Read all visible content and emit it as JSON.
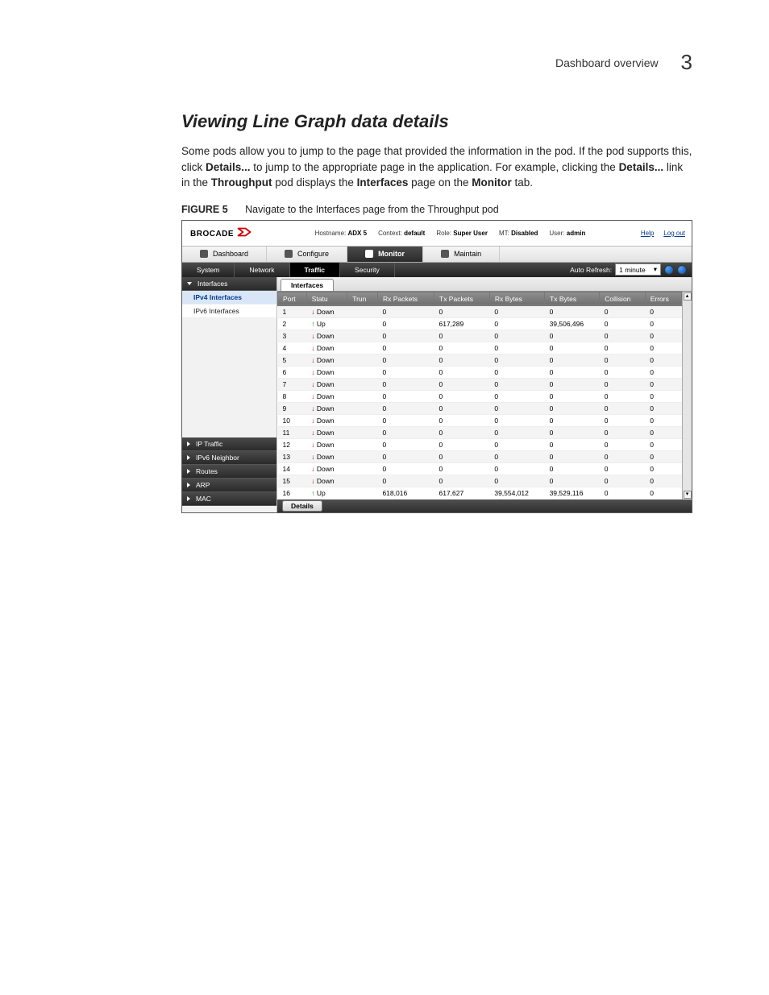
{
  "running_head": {
    "title": "Dashboard overview",
    "page_number": "3"
  },
  "section_title": "Viewing Line Graph data details",
  "body_paragraph": {
    "t1": "Some pods allow you to jump to the page that provided the information in the pod. If the pod supports this, click ",
    "b1": "Details...",
    "t2": " to jump to the appropriate page in the application. For example, clicking the ",
    "b2": "Details...",
    "t3": " link in the ",
    "b3": "Throughput",
    "t4": " pod displays the ",
    "b4": "Interfaces",
    "t5": " page on the ",
    "b5": "Monitor",
    "t6": " tab."
  },
  "figure": {
    "label": "FIGURE 5",
    "caption": "Navigate to the Interfaces page from the Throughput pod"
  },
  "shot": {
    "brand": "BROCADE",
    "top_meta": {
      "hostname_label": "Hostname:",
      "hostname": "ADX 5",
      "context_label": "Context:",
      "context": "default",
      "role_label": "Role:",
      "role": "Super User",
      "mt_label": "MT:",
      "mt": "Disabled",
      "user_label": "User:",
      "user": "admin"
    },
    "top_right": {
      "help": "Help",
      "logout": "Log out"
    },
    "menubar": [
      {
        "label": "Dashboard",
        "sel": false
      },
      {
        "label": "Configure",
        "sel": false
      },
      {
        "label": "Monitor",
        "sel": true
      },
      {
        "label": "Maintain",
        "sel": false
      }
    ],
    "subbar": {
      "tabs": [
        {
          "label": "System",
          "sel": false
        },
        {
          "label": "Network",
          "sel": false
        },
        {
          "label": "Traffic",
          "sel": true
        },
        {
          "label": "Security",
          "sel": false
        }
      ],
      "auto_refresh_label": "Auto Refresh:",
      "auto_refresh_value": "1 minute"
    },
    "sidebar": {
      "sections": [
        {
          "title": "Interfaces",
          "expanded": true,
          "items": [
            {
              "label": "IPv4 Interfaces",
              "active": true
            },
            {
              "label": "IPv6 Interfaces",
              "active": false
            }
          ]
        },
        {
          "title": "IP Traffic",
          "expanded": false,
          "items": []
        },
        {
          "title": "IPv6 Neighbor",
          "expanded": false,
          "items": []
        },
        {
          "title": "Routes",
          "expanded": false,
          "items": []
        },
        {
          "title": "ARP",
          "expanded": false,
          "items": []
        },
        {
          "title": "MAC",
          "expanded": false,
          "items": []
        }
      ]
    },
    "content_tab": "Interfaces",
    "columns": [
      "Port",
      "Statu",
      "Trun",
      "Rx Packets",
      "Tx Packets",
      "Rx Bytes",
      "Tx Bytes",
      "Collision",
      "Errors"
    ],
    "rows": [
      {
        "port": "1",
        "status": "Down",
        "trunk": "",
        "rx_p": "0",
        "tx_p": "0",
        "rx_b": "0",
        "tx_b": "0",
        "col": "0",
        "err": "0"
      },
      {
        "port": "2",
        "status": "Up",
        "trunk": "",
        "rx_p": "0",
        "tx_p": "617,289",
        "rx_b": "0",
        "tx_b": "39,506,496",
        "col": "0",
        "err": "0"
      },
      {
        "port": "3",
        "status": "Down",
        "trunk": "",
        "rx_p": "0",
        "tx_p": "0",
        "rx_b": "0",
        "tx_b": "0",
        "col": "0",
        "err": "0"
      },
      {
        "port": "4",
        "status": "Down",
        "trunk": "",
        "rx_p": "0",
        "tx_p": "0",
        "rx_b": "0",
        "tx_b": "0",
        "col": "0",
        "err": "0"
      },
      {
        "port": "5",
        "status": "Down",
        "trunk": "",
        "rx_p": "0",
        "tx_p": "0",
        "rx_b": "0",
        "tx_b": "0",
        "col": "0",
        "err": "0"
      },
      {
        "port": "6",
        "status": "Down",
        "trunk": "",
        "rx_p": "0",
        "tx_p": "0",
        "rx_b": "0",
        "tx_b": "0",
        "col": "0",
        "err": "0"
      },
      {
        "port": "7",
        "status": "Down",
        "trunk": "",
        "rx_p": "0",
        "tx_p": "0",
        "rx_b": "0",
        "tx_b": "0",
        "col": "0",
        "err": "0"
      },
      {
        "port": "8",
        "status": "Down",
        "trunk": "",
        "rx_p": "0",
        "tx_p": "0",
        "rx_b": "0",
        "tx_b": "0",
        "col": "0",
        "err": "0"
      },
      {
        "port": "9",
        "status": "Down",
        "trunk": "",
        "rx_p": "0",
        "tx_p": "0",
        "rx_b": "0",
        "tx_b": "0",
        "col": "0",
        "err": "0"
      },
      {
        "port": "10",
        "status": "Down",
        "trunk": "",
        "rx_p": "0",
        "tx_p": "0",
        "rx_b": "0",
        "tx_b": "0",
        "col": "0",
        "err": "0"
      },
      {
        "port": "11",
        "status": "Down",
        "trunk": "",
        "rx_p": "0",
        "tx_p": "0",
        "rx_b": "0",
        "tx_b": "0",
        "col": "0",
        "err": "0"
      },
      {
        "port": "12",
        "status": "Down",
        "trunk": "",
        "rx_p": "0",
        "tx_p": "0",
        "rx_b": "0",
        "tx_b": "0",
        "col": "0",
        "err": "0"
      },
      {
        "port": "13",
        "status": "Down",
        "trunk": "",
        "rx_p": "0",
        "tx_p": "0",
        "rx_b": "0",
        "tx_b": "0",
        "col": "0",
        "err": "0"
      },
      {
        "port": "14",
        "status": "Down",
        "trunk": "",
        "rx_p": "0",
        "tx_p": "0",
        "rx_b": "0",
        "tx_b": "0",
        "col": "0",
        "err": "0"
      },
      {
        "port": "15",
        "status": "Down",
        "trunk": "",
        "rx_p": "0",
        "tx_p": "0",
        "rx_b": "0",
        "tx_b": "0",
        "col": "0",
        "err": "0"
      },
      {
        "port": "16",
        "status": "Up",
        "trunk": "",
        "rx_p": "618,016",
        "tx_p": "617,627",
        "rx_b": "39,554,012",
        "tx_b": "39,529,116",
        "col": "0",
        "err": "0"
      }
    ],
    "details_button": "Details"
  }
}
